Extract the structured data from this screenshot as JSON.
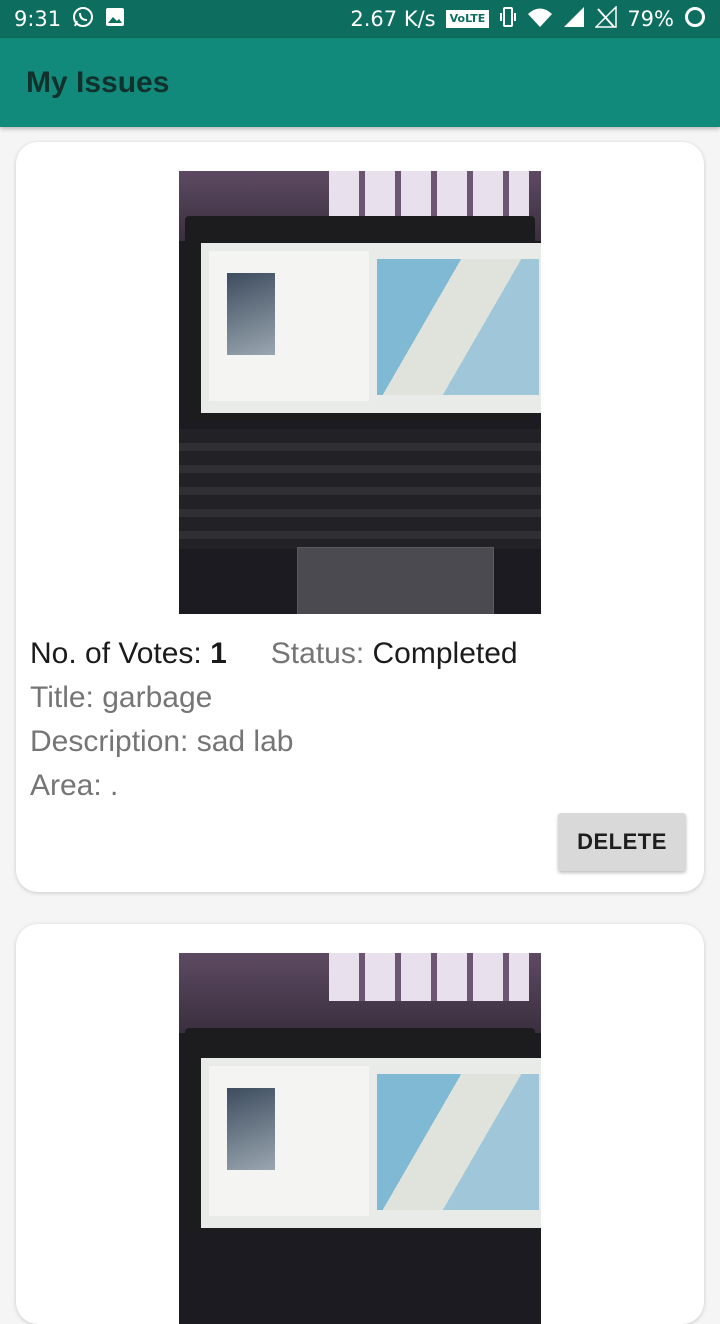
{
  "status_bar": {
    "time": "9:31",
    "net_speed": "2.67 K/s",
    "volte": "VoLTE",
    "battery": "79%"
  },
  "app_bar": {
    "title": "My Issues"
  },
  "issues": [
    {
      "votes_label": "No. of Votes: ",
      "votes": "1",
      "status_label": "Status: ",
      "status": "Completed",
      "title": "Title: garbage",
      "description": "Description: sad lab",
      "area": "Area: .",
      "delete_label": "DELETE"
    }
  ],
  "colors": {
    "status_bar": "#0d6e5f",
    "app_bar": "#118a7b",
    "card": "#ffffff",
    "button": "#d9d9d9"
  },
  "icons": [
    "whatsapp-icon",
    "gallery-icon",
    "vibrate-icon",
    "wifi-icon",
    "signal-icon",
    "no-signal-icon",
    "battery-icon"
  ]
}
